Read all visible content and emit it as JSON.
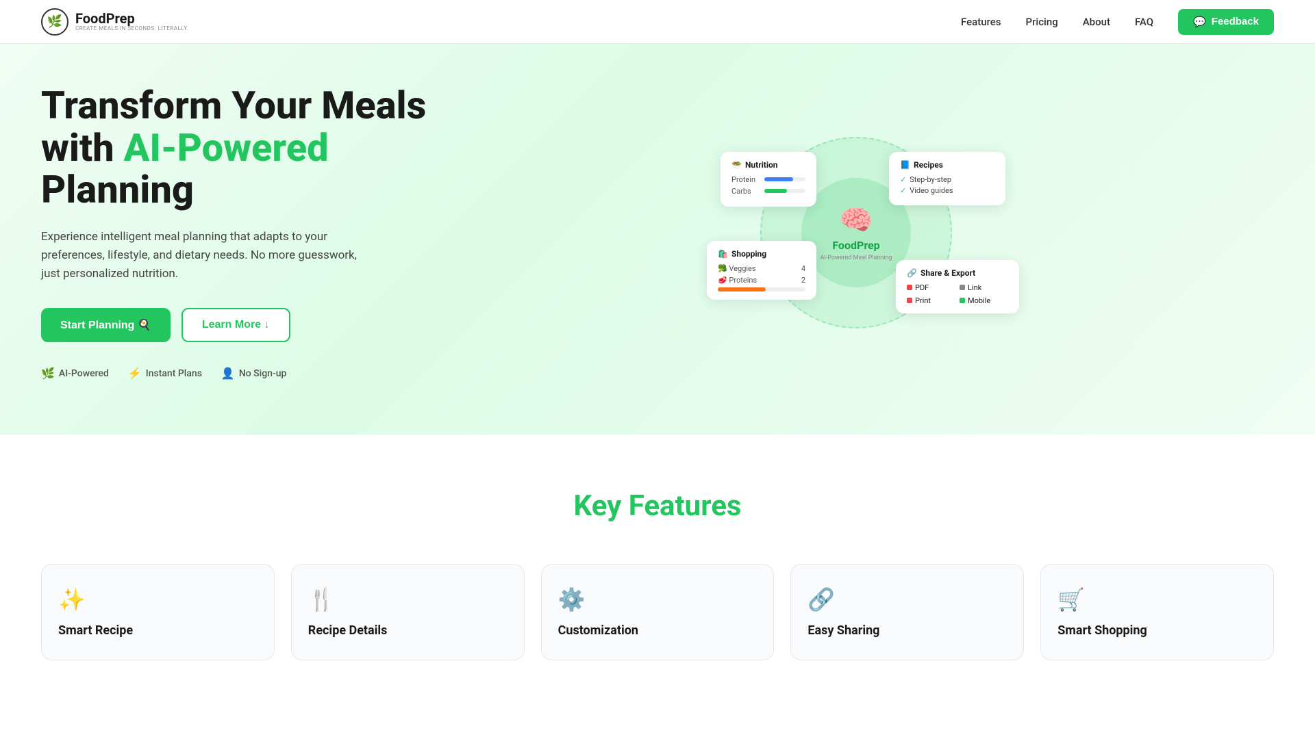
{
  "nav": {
    "logo_name": "FoodPrep",
    "logo_tagline": "Create meals in seconds. Literally.",
    "links": [
      {
        "label": "Features",
        "href": "#features"
      },
      {
        "label": "Pricing",
        "href": "#pricing"
      },
      {
        "label": "About",
        "href": "#about"
      },
      {
        "label": "FAQ",
        "href": "#faq"
      }
    ],
    "feedback_label": "Feedback",
    "feedback_icon": "💬"
  },
  "hero": {
    "title_start": "Transform Your Meals with ",
    "title_green": "AI-Powered",
    "title_end": " Planning",
    "subtitle": "Experience intelligent meal planning that adapts to your preferences, lifestyle, and dietary needs. No more guesswork, just personalized nutrition.",
    "btn_primary": "Start Planning 🍳",
    "btn_secondary": "Learn More ↓",
    "badges": [
      {
        "icon": "🌿",
        "label": "AI-Powered"
      },
      {
        "icon": "⚡",
        "label": "Instant Plans"
      },
      {
        "icon": "👤",
        "label": "No Sign-up"
      }
    ],
    "illustration": {
      "brand": "FoodPrep",
      "brand_sub": "AI-Powered Meal Planning",
      "card_nutrition": {
        "title": "Nutrition",
        "rows": [
          {
            "label": "Protein",
            "fill": 70,
            "color": "blue"
          },
          {
            "label": "Carbs",
            "fill": 55,
            "color": "green"
          }
        ]
      },
      "card_recipes": {
        "title": "Recipes",
        "items": [
          "Step-by-step",
          "Video guides"
        ]
      },
      "card_shopping": {
        "title": "Shopping",
        "items": [
          {
            "label": "Veggies",
            "count": "4",
            "color": "green"
          },
          {
            "label": "Proteins",
            "count": "2",
            "color": "orange"
          }
        ]
      },
      "card_share": {
        "title": "Share & Export",
        "items": [
          {
            "label": "PDF",
            "color": "red"
          },
          {
            "label": "Link",
            "color": "gray"
          },
          {
            "label": "Print",
            "color": "red"
          },
          {
            "label": "Mobile",
            "color": "green"
          }
        ]
      }
    }
  },
  "features_section": {
    "title": "Key Features",
    "cards": [
      {
        "icon": "✨",
        "name": "Smart Recipe"
      },
      {
        "icon": "🍴",
        "name": "Recipe Details"
      },
      {
        "icon": "⚙️",
        "name": "Customization"
      },
      {
        "icon": "🔗",
        "name": "Easy Sharing"
      },
      {
        "icon": "🛒",
        "name": "Smart Shopping"
      }
    ]
  }
}
